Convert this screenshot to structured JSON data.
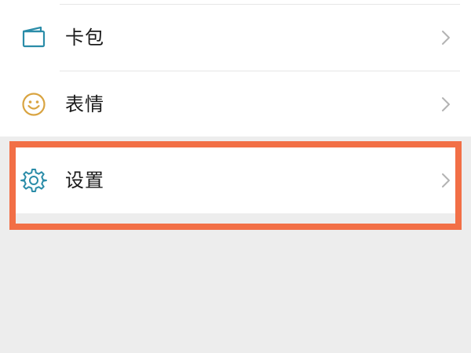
{
  "menu": {
    "items": [
      {
        "id": "card",
        "label": "卡包",
        "icon": "card-icon"
      },
      {
        "id": "sticker",
        "label": "表情",
        "icon": "emoji-icon"
      }
    ],
    "settings": {
      "label": "设置",
      "icon": "gear-icon"
    }
  },
  "colors": {
    "background": "#ededed",
    "surface": "#ffffff",
    "highlight": "#f26f46",
    "card_icon": "#2a8ca8",
    "emoji_icon": "#d9a441",
    "gear_icon": "#2a8ca8",
    "chevron": "#b3b3b3"
  }
}
